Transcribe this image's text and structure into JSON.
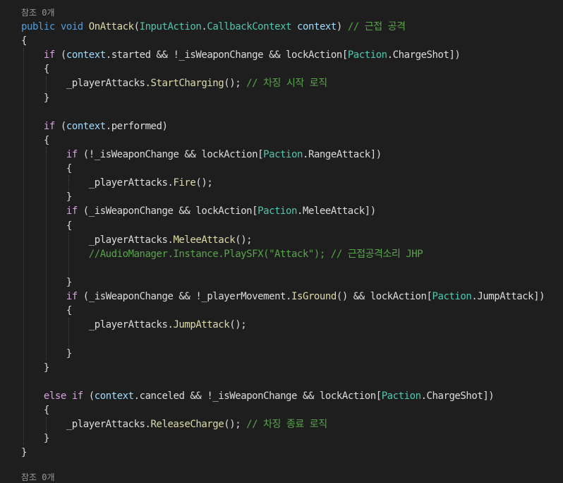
{
  "editor": {
    "codelens_top": "참조 0개",
    "codelens_bottom": "참조 0개",
    "lines": [
      [
        {
          "t": "public",
          "c": "kw"
        },
        {
          "t": " "
        },
        {
          "t": "void",
          "c": "kw"
        },
        {
          "t": " "
        },
        {
          "t": "OnAttack",
          "c": "method"
        },
        {
          "t": "("
        },
        {
          "t": "InputAction",
          "c": "type"
        },
        {
          "t": "."
        },
        {
          "t": "CallbackContext",
          "c": "type"
        },
        {
          "t": " "
        },
        {
          "t": "context",
          "c": "param"
        },
        {
          "t": ") "
        },
        {
          "t": "// 근접 공격",
          "c": "cmt"
        }
      ],
      [
        {
          "t": "{"
        }
      ],
      [
        {
          "t": "    "
        },
        {
          "t": "if",
          "c": "ctl"
        },
        {
          "t": " ("
        },
        {
          "t": "context",
          "c": "param"
        },
        {
          "t": ".started && !_isWeaponChange && lockAction["
        },
        {
          "t": "Paction",
          "c": "type"
        },
        {
          "t": ".ChargeShot])"
        }
      ],
      [
        {
          "t": "    {"
        }
      ],
      [
        {
          "t": "        _playerAttacks."
        },
        {
          "t": "StartCharging",
          "c": "method"
        },
        {
          "t": "(); "
        },
        {
          "t": "// 차징 시작 로직",
          "c": "cmt"
        }
      ],
      [
        {
          "t": "    }"
        }
      ],
      [
        {
          "t": ""
        }
      ],
      [
        {
          "t": "    "
        },
        {
          "t": "if",
          "c": "ctl"
        },
        {
          "t": " ("
        },
        {
          "t": "context",
          "c": "param"
        },
        {
          "t": ".performed)"
        }
      ],
      [
        {
          "t": "    {"
        }
      ],
      [
        {
          "t": "        "
        },
        {
          "t": "if",
          "c": "ctl"
        },
        {
          "t": " (!_isWeaponChange && lockAction["
        },
        {
          "t": "Paction",
          "c": "type"
        },
        {
          "t": ".RangeAttack])"
        }
      ],
      [
        {
          "t": "        {"
        }
      ],
      [
        {
          "t": "            _playerAttacks."
        },
        {
          "t": "Fire",
          "c": "method"
        },
        {
          "t": "();"
        }
      ],
      [
        {
          "t": "        }"
        }
      ],
      [
        {
          "t": "        "
        },
        {
          "t": "if",
          "c": "ctl"
        },
        {
          "t": " (_isWeaponChange && lockAction["
        },
        {
          "t": "Paction",
          "c": "type"
        },
        {
          "t": ".MeleeAttack])"
        }
      ],
      [
        {
          "t": "        {"
        }
      ],
      [
        {
          "t": "            _playerAttacks."
        },
        {
          "t": "MeleeAttack",
          "c": "method"
        },
        {
          "t": "();"
        }
      ],
      [
        {
          "t": "            "
        },
        {
          "t": "//AudioManager.Instance.PlaySFX(\"Attack\"); // 근접공격소리 JHP",
          "c": "cmt"
        }
      ],
      [
        {
          "t": ""
        }
      ],
      [
        {
          "t": "        }"
        }
      ],
      [
        {
          "t": "        "
        },
        {
          "t": "if",
          "c": "ctl"
        },
        {
          "t": " (_isWeaponChange && !_playerMovement."
        },
        {
          "t": "IsGround",
          "c": "method"
        },
        {
          "t": "() && lockAction["
        },
        {
          "t": "Paction",
          "c": "type"
        },
        {
          "t": ".JumpAttack])"
        }
      ],
      [
        {
          "t": "        {"
        }
      ],
      [
        {
          "t": "            _playerAttacks."
        },
        {
          "t": "JumpAttack",
          "c": "method"
        },
        {
          "t": "();"
        }
      ],
      [
        {
          "t": ""
        }
      ],
      [
        {
          "t": "        }"
        }
      ],
      [
        {
          "t": "    }"
        }
      ],
      [
        {
          "t": ""
        }
      ],
      [
        {
          "t": "    "
        },
        {
          "t": "else",
          "c": "ctl"
        },
        {
          "t": " "
        },
        {
          "t": "if",
          "c": "ctl"
        },
        {
          "t": " ("
        },
        {
          "t": "context",
          "c": "param"
        },
        {
          "t": ".canceled && !_isWeaponChange && lockAction["
        },
        {
          "t": "Paction",
          "c": "type"
        },
        {
          "t": ".ChargeShot])"
        }
      ],
      [
        {
          "t": "    {"
        }
      ],
      [
        {
          "t": "        _playerAttacks."
        },
        {
          "t": "ReleaseCharge",
          "c": "method"
        },
        {
          "t": "(); "
        },
        {
          "t": "// 차징 종료 로직",
          "c": "cmt"
        }
      ],
      [
        {
          "t": "    }"
        }
      ],
      [
        {
          "t": "}"
        }
      ]
    ]
  }
}
